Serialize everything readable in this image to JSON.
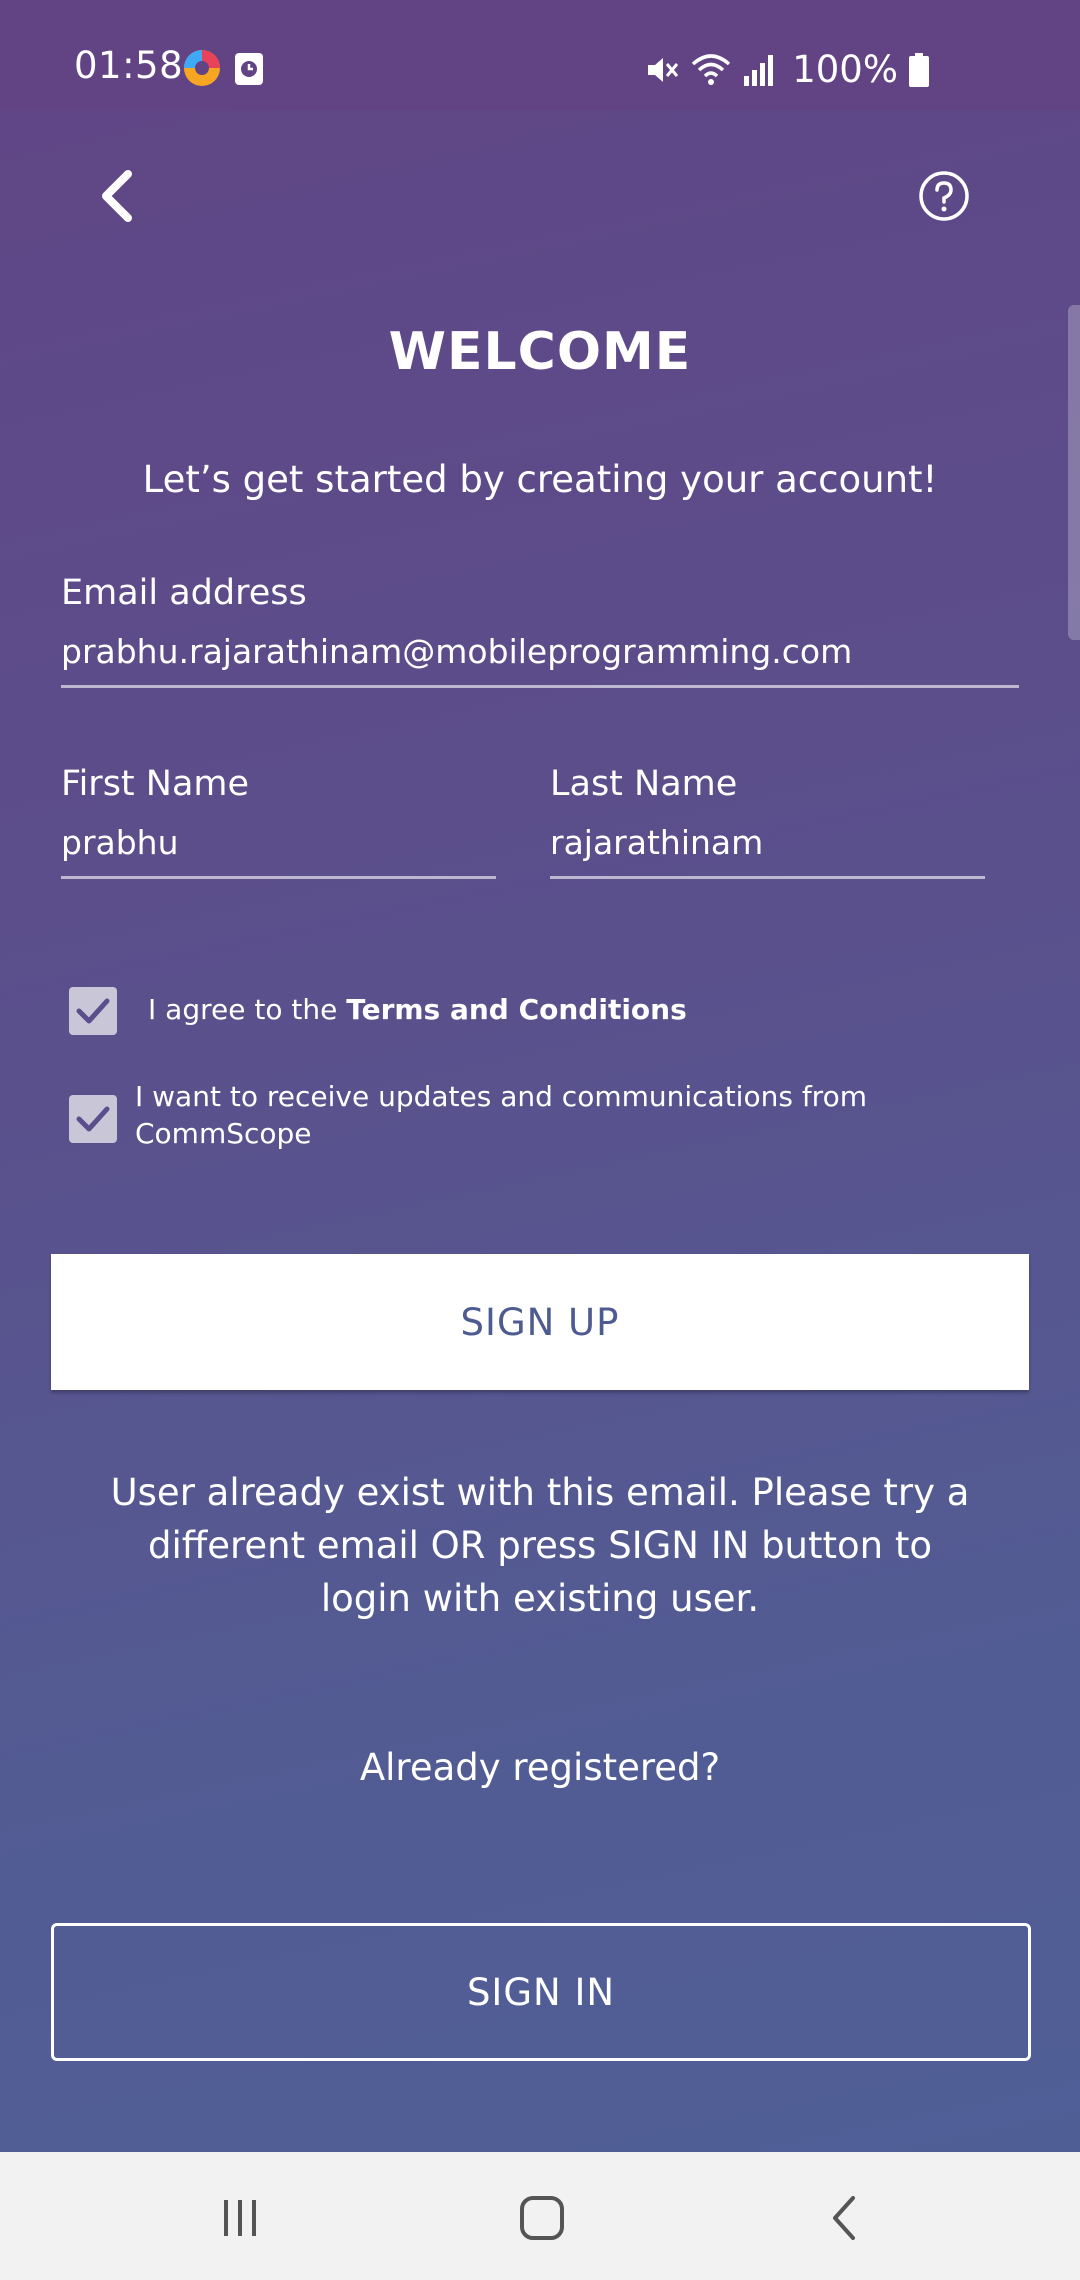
{
  "status": {
    "time": "01:58",
    "battery": "100%"
  },
  "header": {
    "back_icon": "chevron-left-icon",
    "help_icon": "help-circle-icon"
  },
  "main": {
    "title": "WELCOME",
    "subtitle": "Let’s get started by creating your account!",
    "email": {
      "label": "Email address",
      "value": "prabhu.rajarathinam@mobileprogramming.com"
    },
    "first_name": {
      "label": "First Name",
      "value": "prabhu"
    },
    "last_name": {
      "label": "Last Name",
      "value": "rajarathinam"
    },
    "terms": {
      "prefix": "I agree to the ",
      "link": "Terms and Conditions",
      "checked": true
    },
    "updates": {
      "text": "I want to receive updates and communications from CommScope",
      "checked": true
    },
    "signup_label": "SIGN UP",
    "error_message": "User already exist with this email. Please try a different email OR press SIGN IN button to login with existing user.",
    "already_registered": "Already registered?",
    "signin_label": "SIGN IN"
  },
  "colors": {
    "background_top": "#614585",
    "background_bottom": "#4f5f96",
    "button_text": "#4d5b90"
  }
}
